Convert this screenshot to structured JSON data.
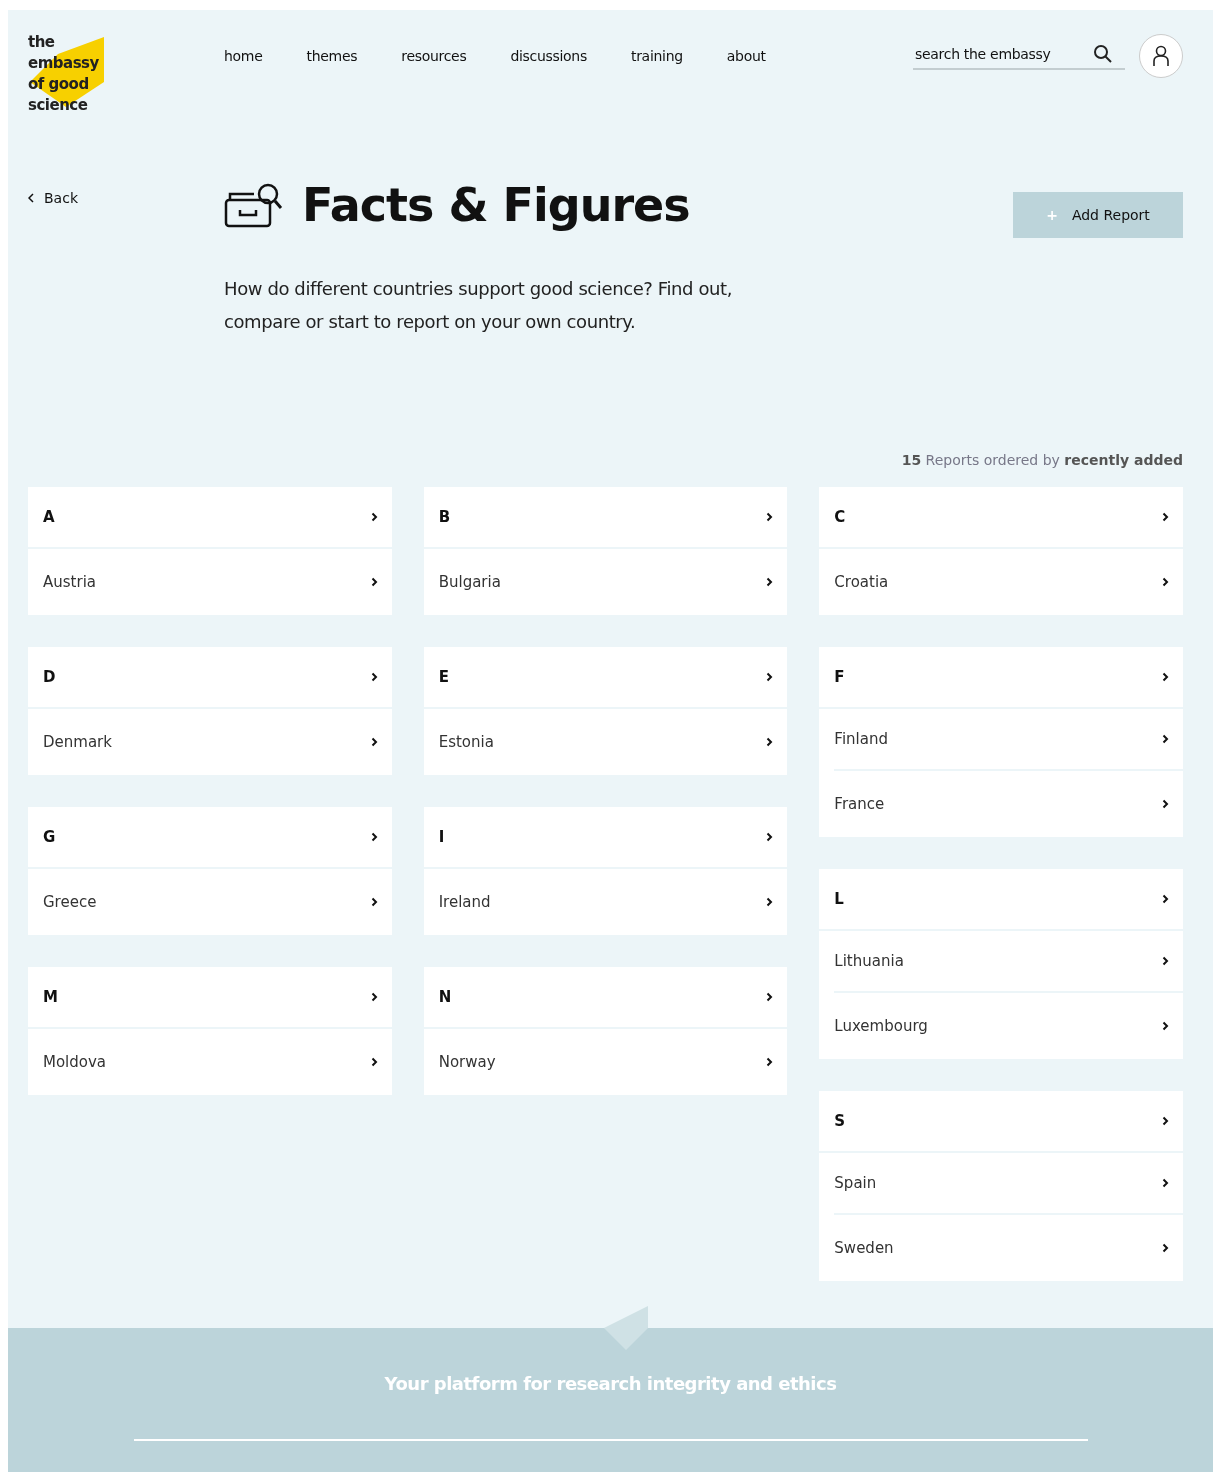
{
  "logo": {
    "lines": [
      "the",
      "embassy",
      "of good",
      "science"
    ]
  },
  "nav": [
    {
      "label": "home"
    },
    {
      "label": "themes"
    },
    {
      "label": "resources"
    },
    {
      "label": "discussions"
    },
    {
      "label": "training"
    },
    {
      "label": "about"
    }
  ],
  "search": {
    "placeholder": "search the embassy"
  },
  "back": "Back",
  "title": "Facts & Figures",
  "intro": "How do different countries support good science? Find out, compare or start to report on your own country.",
  "add_button": {
    "icon": "+",
    "label": "Add Report"
  },
  "summary": "**15** Reports ordered by **recently added**",
  "columns": [
    [
      {
        "letter": "A",
        "countries": [
          "Austria"
        ]
      },
      {
        "letter": "D",
        "countries": [
          "Denmark"
        ]
      },
      {
        "letter": "G",
        "countries": [
          "Greece"
        ]
      },
      {
        "letter": "M",
        "countries": [
          "Moldova"
        ]
      }
    ],
    [
      {
        "letter": "B",
        "countries": [
          "Bulgaria"
        ]
      },
      {
        "letter": "E",
        "countries": [
          "Estonia"
        ]
      },
      {
        "letter": "I",
        "countries": [
          "Ireland"
        ]
      },
      {
        "letter": "N",
        "countries": [
          "Norway"
        ]
      }
    ],
    [
      {
        "letter": "C",
        "countries": [
          "Croatia"
        ]
      },
      {
        "letter": "F",
        "countries": [
          "Finland",
          "France"
        ]
      },
      {
        "letter": "L",
        "countries": [
          "Lithuania",
          "Luxembourg"
        ]
      },
      {
        "letter": "S",
        "countries": [
          "Spain",
          "Sweden"
        ]
      }
    ]
  ],
  "footer": {
    "tagline": "Your platform for research integrity and ethics"
  }
}
